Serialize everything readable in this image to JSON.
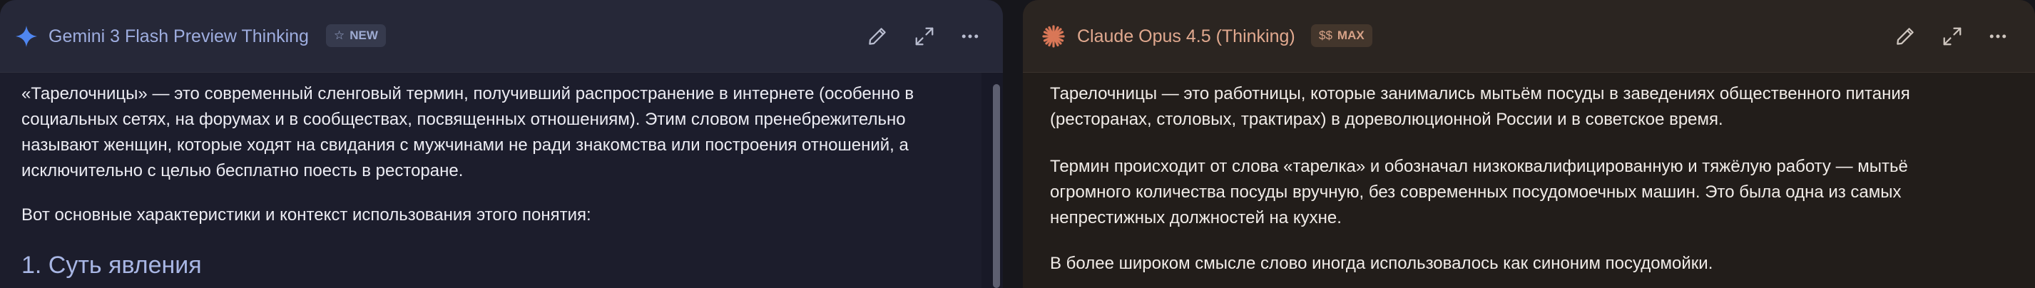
{
  "left_panel": {
    "model_name": "Gemini 3 Flash Preview Thinking",
    "badge_icon": "star-outline-icon",
    "badge_label": "NEW",
    "accent_color": "#9eaddf",
    "paragraphs": [
      "«Тарелочницы» — это современный сленговый термин, получивший распространение в интернете (особенно в социальных сетях, на форумах и в сообществах, посвященных отношениям). Этим словом пренебрежительно называют женщин, которые ходят на свидания с мужчинами не ради знакомства или построения отношений, а исключительно с целью бесплатно поесть в ресторане.",
      "Вот основные характеристики и контекст использования этого понятия:"
    ],
    "heading": "1. Суть явления"
  },
  "right_panel": {
    "model_name": "Claude Opus 4.5 (Thinking)",
    "badge_icon": "$$",
    "badge_label": "MAX",
    "accent_color": "#e1a98f",
    "paragraphs": [
      "Тарелочницы — это работницы, которые занимались мытьём посуды в заведениях общественного питания (ресторанах, столовых, трактирах) в дореволюционной России и в советское время.",
      "Термин происходит от слова «тарелка» и обозначал низкоквалифицированную и тяжёлую работу — мытьё огромного количества посуды вручную, без современных посудомоечных машин. Это была одна из самых непрестижных должностей на кухне.",
      "В более широком смысле слово иногда использовалось как синоним посудомойки."
    ]
  },
  "header_actions": [
    "edit-icon",
    "expand-icon",
    "more-icon"
  ]
}
